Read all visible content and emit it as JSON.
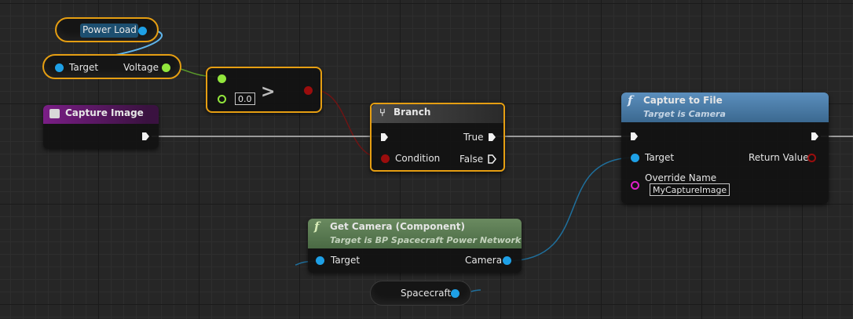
{
  "nodes": {
    "power_load": {
      "label": "Power Load"
    },
    "target_voltage": {
      "target_label": "Target",
      "voltage_label": "Voltage"
    },
    "greater": {
      "operator": ">",
      "input_value": "0.0"
    },
    "capture_image": {
      "title": "Capture Image"
    },
    "branch": {
      "title": "Branch",
      "true_label": "True",
      "condition_label": "Condition",
      "false_label": "False"
    },
    "capture_to_file": {
      "title": "Capture to File",
      "subtitle": "Target is Camera",
      "target_label": "Target",
      "return_label": "Return Value",
      "override_label": "Override Name",
      "override_value": "MyCaptureImage"
    },
    "get_camera": {
      "title": "Get Camera (Component)",
      "subtitle": "Target is BP Spacecraft Power Network",
      "target_label": "Target",
      "camera_label": "Camera"
    },
    "spacecraft": {
      "label": "Spacecraft"
    }
  },
  "icons": {
    "function_glyph": "f",
    "event_icon": "event-icon",
    "branch_icon": "branch-icon"
  },
  "colors": {
    "selection": "#e59e12",
    "object_pin": "#1ea0e6",
    "float_pin": "#92e63c",
    "bool_pin": "#9b0d0d",
    "string_pin": "#e01fc8",
    "event_header": "#7a1e86",
    "function_header": "#4f7ea8",
    "pure_function_header": "#5a7a52"
  }
}
